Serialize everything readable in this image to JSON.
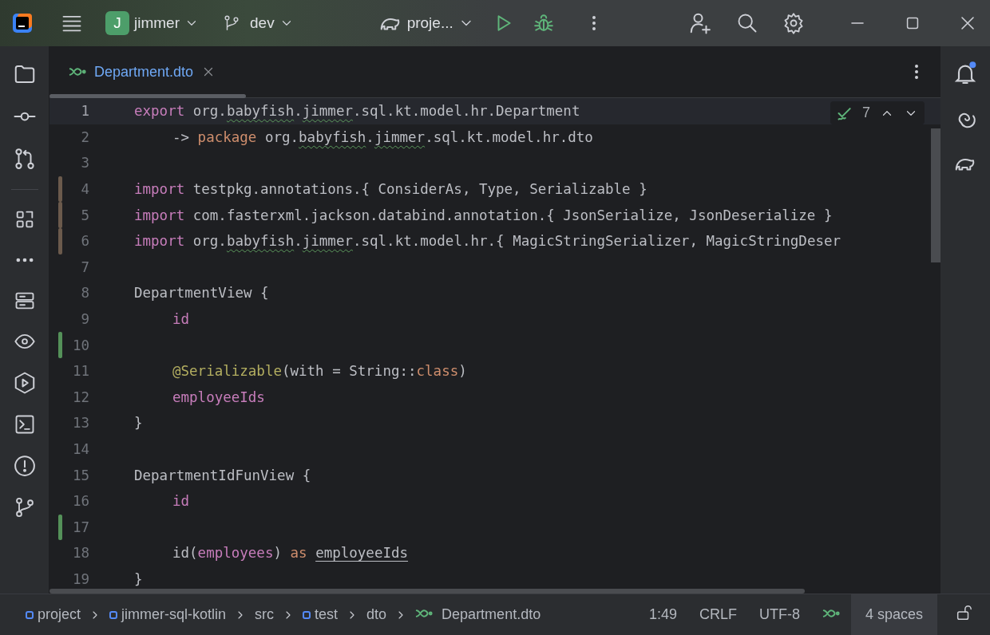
{
  "title_bar": {
    "project": {
      "badge": "J",
      "name": "jimmer"
    },
    "branch": "dev",
    "run_config": "proje..."
  },
  "tab": {
    "label": "Department.dto",
    "selected": true
  },
  "inspections": {
    "count": "7"
  },
  "notifications": {
    "unread": true
  },
  "editor": {
    "lines": [
      {
        "number": "1",
        "current": true,
        "indented": false,
        "tokens": [
          {
            "text": "export",
            "kind": "directive"
          },
          {
            "text": " org.",
            "kind": "plain"
          },
          {
            "text": "babyfish",
            "kind": "typo"
          },
          {
            "text": ".",
            "kind": "plain"
          },
          {
            "text": "jimmer",
            "kind": "typo"
          },
          {
            "text": ".sql.kt.model.hr.Department",
            "kind": "plain"
          }
        ]
      },
      {
        "number": "2",
        "current": false,
        "indented": true,
        "tokens": [
          {
            "text": "-> ",
            "kind": "plain"
          },
          {
            "text": "package",
            "kind": "keyword"
          },
          {
            "text": " org.",
            "kind": "plain"
          },
          {
            "text": "babyfish",
            "kind": "typo"
          },
          {
            "text": ".",
            "kind": "plain"
          },
          {
            "text": "jimmer",
            "kind": "typo"
          },
          {
            "text": ".sql.kt.model.hr.dto",
            "kind": "plain"
          }
        ]
      },
      {
        "number": "3",
        "current": false
      },
      {
        "number": "4",
        "current": false,
        "indented": false,
        "color": "#6b5a4c",
        "tokens": [
          {
            "text": "import",
            "kind": "directive"
          },
          {
            "text": " testpkg.annotations.{ ConsiderAs, Type, Serializable }",
            "kind": "plain"
          }
        ]
      },
      {
        "number": "5",
        "current": false,
        "indented": false,
        "color": "#6b5a4c",
        "tokens": [
          {
            "text": "import",
            "kind": "directive"
          },
          {
            "text": " com.fasterxml.jackson.databind.annotation.{ JsonSerialize, JsonDeserialize }",
            "kind": "plain"
          }
        ]
      },
      {
        "number": "6",
        "current": false,
        "indented": false,
        "color": "#6b5a4c",
        "tokens": [
          {
            "text": "import",
            "kind": "directive"
          },
          {
            "text": " org.",
            "kind": "plain"
          },
          {
            "text": "babyfish",
            "kind": "typo"
          },
          {
            "text": ".",
            "kind": "plain"
          },
          {
            "text": "jimmer",
            "kind": "typo"
          },
          {
            "text": ".sql.kt.model.hr.{ MagicStringSerializer, MagicStringDeser",
            "kind": "plain"
          }
        ]
      },
      {
        "number": "7",
        "current": false
      },
      {
        "number": "8",
        "current": false,
        "indented": false,
        "tokens": [
          {
            "text": "DepartmentView {",
            "kind": "plain"
          }
        ]
      },
      {
        "number": "9",
        "current": false,
        "indented": true,
        "tokens": [
          {
            "text": "id",
            "kind": "property"
          }
        ]
      },
      {
        "number": "10",
        "current": false,
        "color": "#549159"
      },
      {
        "number": "11",
        "current": false,
        "indented": true,
        "tokens": [
          {
            "text": "@Serializable",
            "kind": "annotation"
          },
          {
            "text": "(with = String::",
            "kind": "plain"
          },
          {
            "text": "class",
            "kind": "keyword"
          },
          {
            "text": ")",
            "kind": "plain"
          }
        ]
      },
      {
        "number": "12",
        "current": false,
        "indented": true,
        "tokens": [
          {
            "text": "employeeIds",
            "kind": "property"
          }
        ]
      },
      {
        "number": "13",
        "current": false,
        "indented": false,
        "tokens": [
          {
            "text": "}",
            "kind": "plain"
          }
        ]
      },
      {
        "number": "14",
        "current": false
      },
      {
        "number": "15",
        "current": false,
        "indented": false,
        "tokens": [
          {
            "text": "DepartmentIdFunView {",
            "kind": "plain"
          }
        ]
      },
      {
        "number": "16",
        "current": false,
        "indented": true,
        "tokens": [
          {
            "text": "id",
            "kind": "property"
          }
        ]
      },
      {
        "number": "17",
        "current": false,
        "color": "#549159"
      },
      {
        "number": "18",
        "current": false,
        "indented": true,
        "tokens": [
          {
            "text": "id(",
            "kind": "plain"
          },
          {
            "text": "employees",
            "kind": "property"
          },
          {
            "text": ") ",
            "kind": "plain"
          },
          {
            "text": "as ",
            "kind": "keyword"
          },
          {
            "text": "employeeIds",
            "kind": "link"
          }
        ]
      },
      {
        "number": "19",
        "current": false,
        "indented": false,
        "tokens": [
          {
            "text": "}",
            "kind": "plain"
          }
        ]
      }
    ]
  },
  "status_bar": {
    "breadcrumbs": [
      {
        "label": "project",
        "kind": "module"
      },
      {
        "label": "jimmer-sql-kotlin",
        "kind": "module"
      },
      {
        "label": "src",
        "kind": "folder"
      },
      {
        "label": "test",
        "kind": "module"
      },
      {
        "label": "dto",
        "kind": "folder"
      },
      {
        "label": "Department.dto",
        "kind": "file"
      }
    ],
    "position": "1:49",
    "line_separator": "CRLF",
    "encoding": "UTF-8",
    "indent": "4 spaces"
  }
}
